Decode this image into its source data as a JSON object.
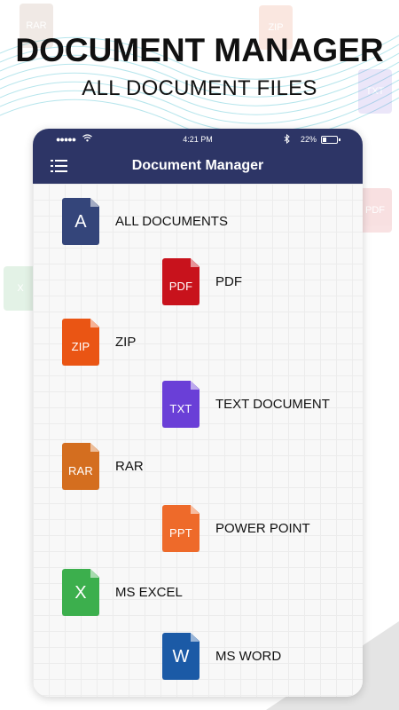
{
  "headline": {
    "title": "DOCUMENT MANAGER",
    "subtitle": "ALL DOCUMENT FILES"
  },
  "background_icons": [
    {
      "label": "RAR",
      "color": "#8f5a3e"
    },
    {
      "label": "ZIP",
      "color": "#e0501c"
    },
    {
      "label": "TXT",
      "color": "#6e48d8"
    },
    {
      "label": "PDF",
      "color": "#d11d24"
    },
    {
      "label": "X",
      "color": "#2e9e45"
    }
  ],
  "status_bar": {
    "signal": "●●●●●",
    "time": "4:21 PM",
    "battery_percent": "22%"
  },
  "app_bar": {
    "title": "Document Manager",
    "color": "#2d3566"
  },
  "documents": [
    {
      "label": "ALL DOCUMENTS",
      "icon": "document-a-icon",
      "icon_text": "A",
      "color": "#34457a"
    },
    {
      "label": "PDF",
      "icon": "pdf-file-icon",
      "icon_text": "PDF",
      "color": "#c8121c"
    },
    {
      "label": "ZIP",
      "icon": "zip-file-icon",
      "icon_text": "ZIP",
      "color": "#ea5514"
    },
    {
      "label": "TEXT DOCUMENT",
      "icon": "txt-file-icon",
      "icon_text": "TXT",
      "color": "#6a3fd7"
    },
    {
      "label": "RAR",
      "icon": "rar-file-icon",
      "icon_text": "RAR",
      "color": "#d46e1f"
    },
    {
      "label": "POWER POINT",
      "icon": "ppt-file-icon",
      "icon_text": "PPT",
      "color": "#ee6a2a"
    },
    {
      "label": "MS EXCEL",
      "icon": "excel-file-icon",
      "icon_text": "X",
      "color": "#3caf4d"
    },
    {
      "label": "MS WORD",
      "icon": "word-file-icon",
      "icon_text": "W",
      "color": "#1b5aa6"
    }
  ]
}
